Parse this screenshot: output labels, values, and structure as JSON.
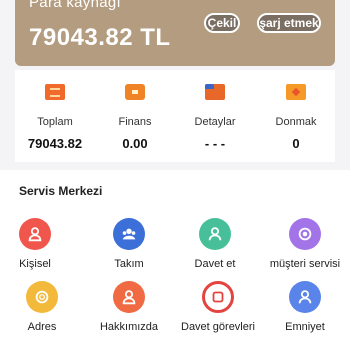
{
  "header": {
    "label": "Para kaynağı",
    "balance": "79043.82 TL",
    "withdraw_label": "Çekil",
    "charge_label": "şarj etmek"
  },
  "stats": [
    {
      "label": "Toplam",
      "value": "79043.82",
      "icon": "wallet-icon"
    },
    {
      "label": "Finans",
      "value": "0.00",
      "icon": "finance-icon"
    },
    {
      "label": "Detaylar",
      "value": "- - -",
      "icon": "details-icon"
    },
    {
      "label": "Donmak",
      "value": "0",
      "icon": "freeze-icon"
    }
  ],
  "service_center": {
    "title": "Servis Merkezi",
    "items": [
      {
        "label": "Kişisel",
        "icon": "personal-icon",
        "color": "#f0564b"
      },
      {
        "label": "Takım",
        "icon": "team-icon",
        "color": "#3c6fd8"
      },
      {
        "label": "Davet et",
        "icon": "invite-icon",
        "color": "#47c09a"
      },
      {
        "label": "müşteri servisi",
        "icon": "customer-service-icon",
        "color": "#a274e8"
      },
      {
        "label": "Adres",
        "icon": "address-icon",
        "color": "#f2b93b"
      },
      {
        "label": "Hakkımızda",
        "icon": "about-icon",
        "color": "#f06a44"
      },
      {
        "label": "Davet görevleri",
        "icon": "invite-tasks-icon",
        "color": "#e3443f"
      },
      {
        "label": "Emniyet",
        "icon": "security-icon",
        "color": "#5a84e9"
      }
    ]
  }
}
